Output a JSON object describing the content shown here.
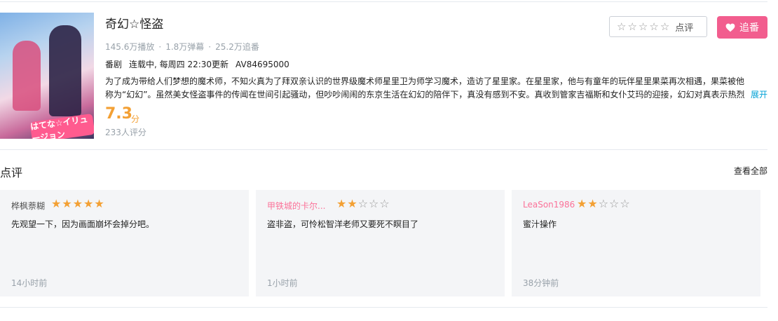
{
  "show": {
    "title": "奇幻☆怪盗",
    "stats": {
      "plays": "145.6万播放",
      "danmaku": "1.8万弹幕",
      "follows": "25.2万追番"
    },
    "type": "番剧",
    "schedule": "连载中, 每周四 22:30更新",
    "av_id": "AV84695000",
    "description": "为了成为带给人们梦想的魔术师，不知火真为了拜双亲认识的世界级魔术师星里卫为师学习魔术，造访了星里家。在星里家，他与有童年的玩伴星里果菜再次相遇，果菜被他称为“幻幻”。虽然美女怪盗事件的传闻在世间引起骚动，但吵吵闹闹的东京生活在幻幻的陪伴下，真没有感到不安。真收到管家吉福斯和女仆艾玛的迎接，幻幻对真表示热烈欢",
    "expand_label": "展开",
    "score": "7.3",
    "score_unit": "分",
    "raters": "233人评分",
    "cover_text": "はてな☆イリュージョン"
  },
  "actions": {
    "review_label": "点评",
    "follow_label": "追番"
  },
  "reviews_section": {
    "title": "点评",
    "view_all": "查看全部"
  },
  "reviews": [
    {
      "user": "桦枫萘糊",
      "rating": 5,
      "text": "先观望一下，因为画面崩坏会掉分吧。",
      "time": "14小时前"
    },
    {
      "user": "甲铁城的卡尔...",
      "rating": 2,
      "text": "盗非盗，可怜松智洋老师又要死不瞑目了",
      "time": "1小时前"
    },
    {
      "user": "LeaSon1986",
      "rating": 2,
      "text": "蜜汁操作",
      "time": "38分钟前"
    }
  ],
  "colors": {
    "accent_pink": "#f25d8e",
    "score_orange": "#f3a034",
    "link_blue": "#00a1d6"
  }
}
